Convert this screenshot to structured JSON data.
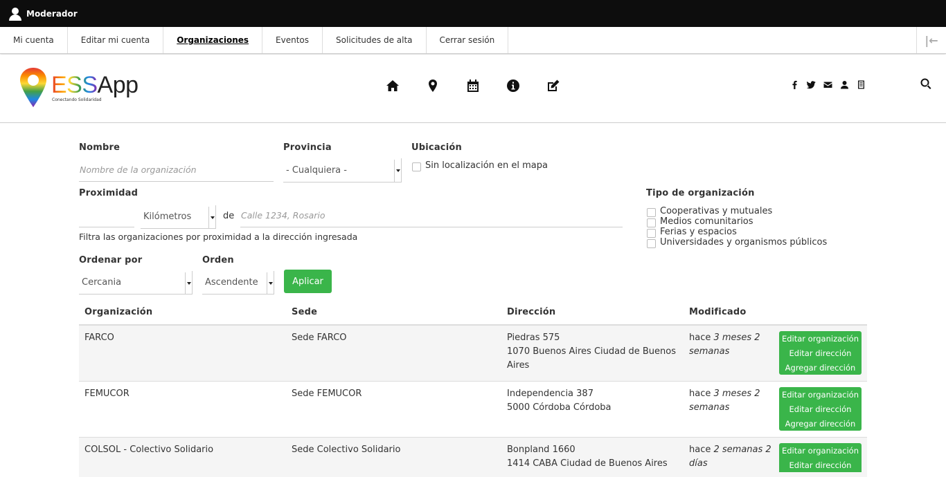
{
  "admin_bar": {
    "user_label": "Moderador"
  },
  "tabs": [
    {
      "label": "Mi cuenta",
      "active": false
    },
    {
      "label": "Editar mi cuenta",
      "active": false
    },
    {
      "label": "Organizaciones",
      "active": true
    },
    {
      "label": "Eventos",
      "active": false
    },
    {
      "label": "Solicitudes de alta",
      "active": false
    },
    {
      "label": "Cerrar sesión",
      "active": false
    }
  ],
  "header": {
    "logo_part1": "ESS",
    "logo_part2": "App",
    "tagline": "Conectando Solidaridad",
    "nav_icons": [
      "home-icon",
      "map-marker-icon",
      "calendar-icon",
      "info-icon",
      "edit-icon"
    ],
    "social_icons": [
      "facebook-icon",
      "twitter-icon",
      "envelope-icon",
      "user-icon",
      "document-icon"
    ]
  },
  "filters": {
    "name_label": "Nombre",
    "name_placeholder": "Nombre de la organización",
    "province_label": "Provincia",
    "province_value": "- Cualquiera -",
    "location_label": "Ubicación",
    "no_location_label": "Sin localización en el mapa",
    "proximity_label": "Proximidad",
    "proximity_unit": "Kilómetros",
    "proximity_de": "de",
    "proximity_address_placeholder": "Calle 1234, Rosario",
    "proximity_help": "Filtra las organizaciones por proximidad a la dirección ingresada",
    "org_type_label": "Tipo de organización",
    "org_types": [
      "Cooperativas y mutuales",
      "Medios comunitarios",
      "Ferias y espacios",
      "Universidades y organismos públicos"
    ],
    "sort_by_label": "Ordenar por",
    "sort_by_value": "Cercania",
    "order_label": "Orden",
    "order_value": "Ascendente",
    "apply_label": "Aplicar"
  },
  "table": {
    "headers": [
      "Organización",
      "Sede",
      "Dirección",
      "Modificado"
    ],
    "rows": [
      {
        "org": "FARCO",
        "sede": "Sede FARCO",
        "dir1": "Piedras 575",
        "dir2": "1070 Buenos Aires Ciudad de Buenos Aires",
        "mod_prefix": "hace ",
        "mod_em": "3 meses 2 semanas",
        "actions": [
          "Editar organización",
          "Editar dirección",
          "Agregar dirección"
        ]
      },
      {
        "org": "FEMUCOR",
        "sede": "Sede FEMUCOR",
        "dir1": "Independencia 387",
        "dir2": "5000 Córdoba Córdoba",
        "mod_prefix": "hace ",
        "mod_em": "3 meses 2 semanas",
        "actions": [
          "Editar organización",
          "Editar dirección",
          "Agregar dirección"
        ]
      },
      {
        "org": "COLSOL - Colectivo Solidario",
        "sede": "Sede Colectivo Solidario",
        "dir1": "Bonpland 1660",
        "dir2": "1414 CABA Ciudad de Buenos Aires",
        "mod_prefix": "hace ",
        "mod_em": "2 semanas 2 días",
        "actions": [
          "Editar organización",
          "Editar dirección"
        ]
      }
    ]
  }
}
